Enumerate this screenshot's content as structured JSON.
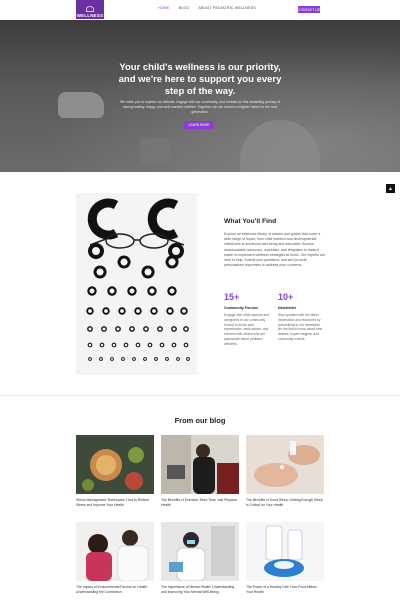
{
  "header": {
    "logo_text": "WELLNESS",
    "nav": [
      {
        "label": "Home",
        "active": true
      },
      {
        "label": "Blog",
        "active": false
      },
      {
        "label": "About Pediatric Wellness",
        "active": false
      }
    ],
    "contact_label": "Contact Us"
  },
  "hero": {
    "title": "Your child's wellness is our priority, and we're here to support you every step of the way.",
    "text": "We invite you to explore our website, engage with our community, and embark on this rewarding journey of raising healthy, happy, and well-rounded children. Together, we can ensure a brighter future for the next generation.",
    "button_label": "Learn More"
  },
  "scroll_top": {
    "icon": "chevron-up-icon",
    "glyph": "▲"
  },
  "find": {
    "title": "What You'll Find",
    "text": "Explore an extensive library of articles and guides that cover a wide range of topics, from child nutrition and developmental milestones to emotional well-being and education. Access downloadable resources, checklists, and templates to make it easier to implement wellness strategies at home. Our experts are here to help. Submit your questions, and we'll provide personalized responses to address your concerns.",
    "stats": [
      {
        "number": "15+",
        "label": "Community Forums",
        "text": "Engage with other parents and caregivers in our community forums to share your experiences, seek advice, and connect with others who are passionate about pediatric wellness."
      },
      {
        "number": "10+",
        "label": "Newsletter",
        "text": "Stay updated with the latest information and resources by subscribing to our newsletter. Be the first to know about new articles, expert insights, and community events."
      }
    ]
  },
  "blog": {
    "title": "From our blog",
    "posts": [
      {
        "caption": "Stress Management Techniques: How to Relieve Stress and Improve Your Health"
      },
      {
        "caption": "The Benefits of Exercise: More Than Just Physical Health"
      },
      {
        "caption": "The Benefits of Good Sleep: Getting Enough Sleep Is Critical for Your Health"
      },
      {
        "caption": "The Impact of Environmental Factors on Health: Understanding the Connection"
      },
      {
        "caption": "The Importance of Mental Health: Understanding and Improving Your Mental Well-Being"
      },
      {
        "caption": "The Power of a Healthy Diet: How Food Affects Your Health"
      }
    ]
  }
}
